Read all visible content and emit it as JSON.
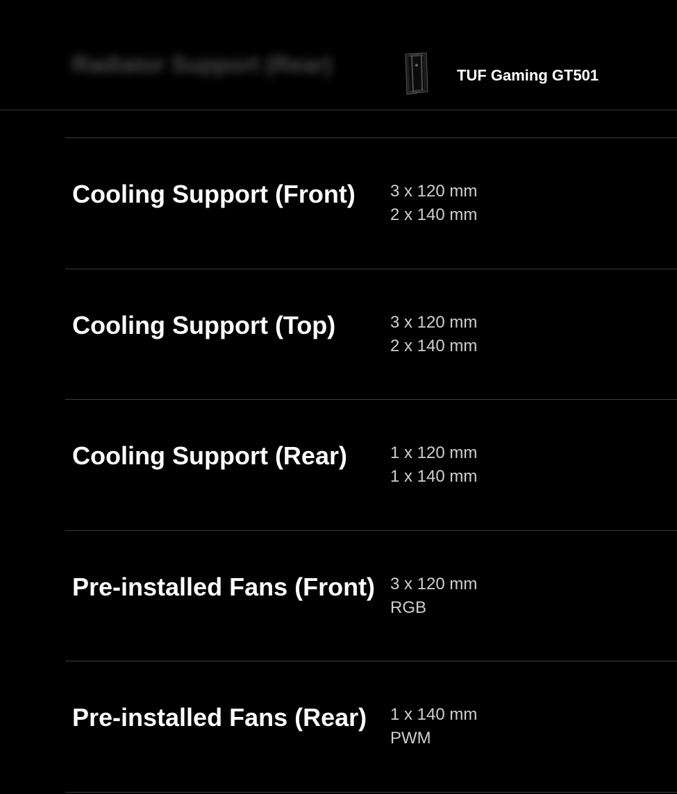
{
  "header": {
    "blurred_title": "Radiator Support (Rear)",
    "product_name": "TUF Gaming GT501",
    "product_image_icon": "pc-case-icon"
  },
  "rows": [
    {
      "label": "Cooling Support (Front)",
      "values": [
        "3 x 120 mm",
        "2 x 140 mm"
      ]
    },
    {
      "label": "Cooling Support (Top)",
      "values": [
        "3 x 120 mm",
        "2 x 140 mm"
      ]
    },
    {
      "label": "Cooling Support (Rear)",
      "values": [
        "1 x 120 mm",
        "1 x 140 mm"
      ]
    },
    {
      "label": "Pre-installed Fans (Front)",
      "values": [
        "3 x 120 mm",
        "RGB"
      ]
    },
    {
      "label": "Pre-installed Fans (Rear)",
      "values": [
        "1 x 140 mm",
        "PWM"
      ]
    }
  ]
}
